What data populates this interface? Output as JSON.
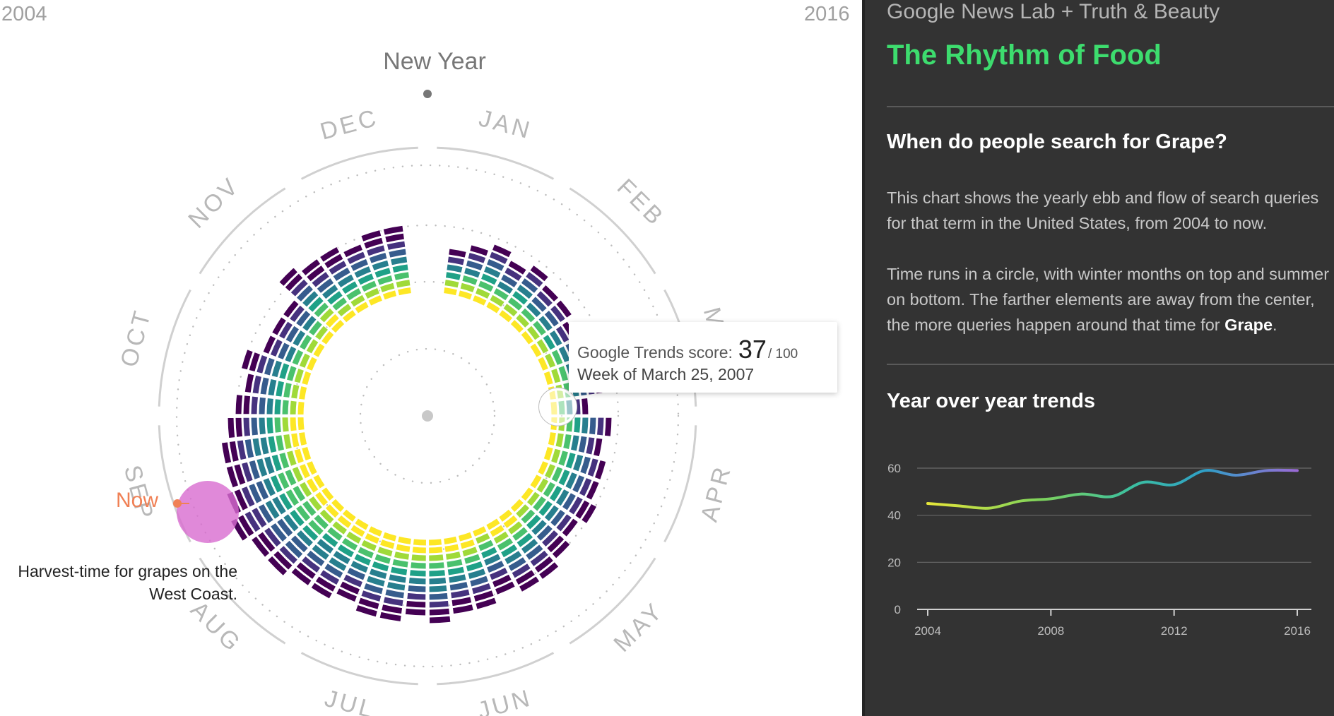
{
  "years": {
    "start": "2004",
    "end": "2016"
  },
  "new_year_label": "New Year",
  "months": [
    "JAN",
    "FEB",
    "MAR",
    "APR",
    "MAY",
    "JUN",
    "JUL",
    "AUG",
    "SEP",
    "OCT",
    "NOV",
    "DEC"
  ],
  "tooltip": {
    "score_label": "Google Trends score:",
    "score_value": "37",
    "score_max": "/ 100",
    "week": "Week of March 25, 2007"
  },
  "now_label": "Now",
  "annotation": {
    "line1": "Harvest-time for grapes on the",
    "line2": "West Coast."
  },
  "sidebar": {
    "credit": "Google News Lab + Truth & Beauty",
    "title": "The Rhythm of Food",
    "question_prefix": "When do people search for ",
    "term": "Grape",
    "question_suffix": "?",
    "para1_line1": "This chart shows the yearly ebb and flow of search queries",
    "para1_line2": "for that term in the United States, from 2004 to now.",
    "para2_line1": "Time runs in a circle, with winter months on top and summer",
    "para2_line2": "on bottom. The farther elements are away from the center,",
    "para2_line3_prefix": "the more queries happen around that time for ",
    "para2_line3_suffix": ".",
    "yoy_heading": "Year over year trends"
  },
  "colors": {
    "accent_green": "#3ddc6e",
    "now_orange": "#f08055",
    "highlight_pink": "#d86ccf",
    "viridis": [
      "#fde725",
      "#a0da39",
      "#4ac16d",
      "#1fa187",
      "#277f8e",
      "#365c8d",
      "#46327e",
      "#440154"
    ]
  },
  "chart_data": [
    {
      "type": "radial_heatmap",
      "description_of_encoding": "Weekly Google Trends score for Grape, 2004–2016; angle = week of year (Jan at top), stacked rings = years, color = score",
      "categories": [
        "JAN",
        "FEB",
        "MAR",
        "APR",
        "MAY",
        "JUN",
        "JUL",
        "AUG",
        "SEP",
        "OCT",
        "NOV",
        "DEC"
      ],
      "series": [
        {
          "name": "Grape",
          "values": [
            50,
            55,
            45,
            46,
            62,
            72,
            75,
            82,
            88,
            70,
            58,
            72
          ]
        }
      ],
      "ylim": [
        0,
        100
      ]
    },
    {
      "type": "line",
      "title": "Year over year trends",
      "x": [
        2004,
        2005,
        2006,
        2007,
        2008,
        2009,
        2010,
        2011,
        2012,
        2013,
        2014,
        2015,
        2016
      ],
      "series": [
        {
          "values": [
            45,
            44,
            43,
            46,
            47,
            49,
            48,
            54,
            53,
            59,
            57,
            59,
            59
          ]
        }
      ],
      "xticks": [
        "2004",
        "2008",
        "2012",
        "2016"
      ],
      "yticks": [
        "0",
        "20",
        "40",
        "60"
      ],
      "xlim": [
        2004,
        2016
      ],
      "ylim": [
        0,
        60
      ],
      "grid": true
    }
  ]
}
